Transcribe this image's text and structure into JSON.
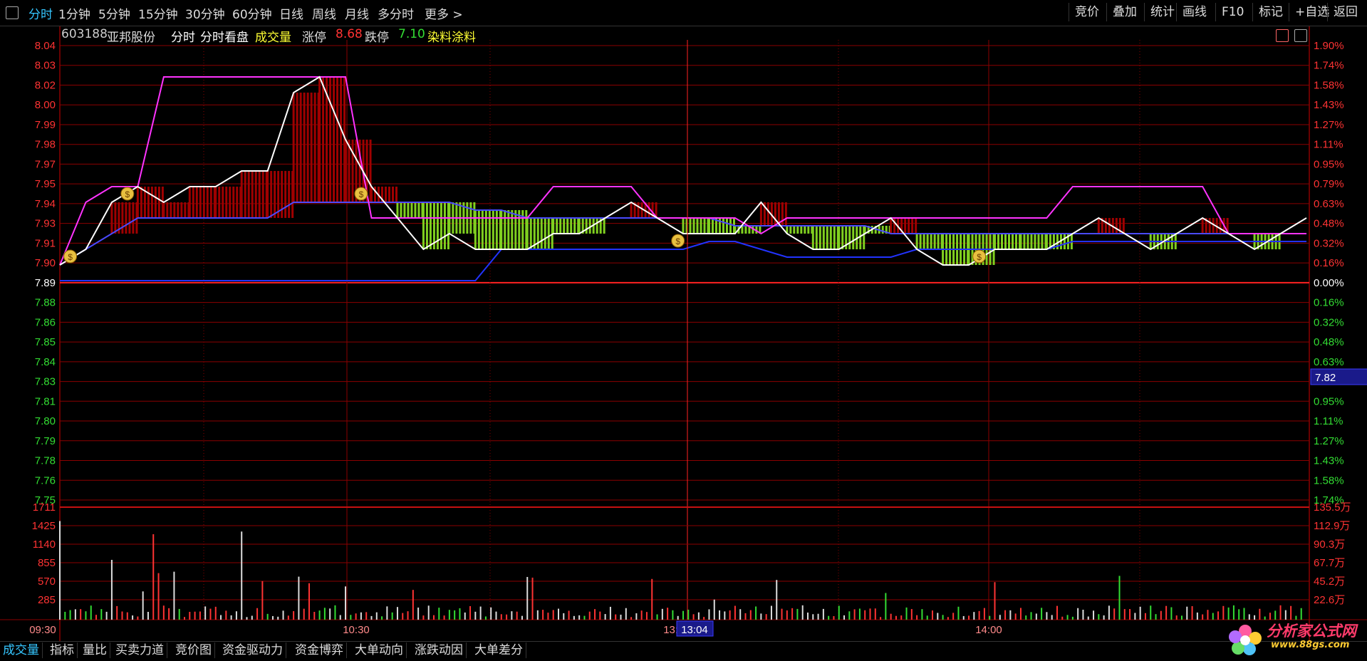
{
  "toolbar": {
    "periods": [
      "分时",
      "1分钟",
      "5分钟",
      "15分钟",
      "30分钟",
      "60分钟",
      "日线",
      "周线",
      "月线",
      "多分时",
      "更多 >"
    ],
    "actions": [
      "竞价",
      "叠加",
      "统计",
      "画线",
      "F10",
      "标记",
      "+自选",
      "返回"
    ]
  },
  "info": {
    "code": "603188",
    "name": "亚邦股份",
    "mode1": "分时",
    "mode2": "分时看盘",
    "volume_label": "成交量",
    "limit_up_label": "涨停",
    "limit_up": "8.68",
    "limit_down_label": "跌停",
    "limit_down": "7.10",
    "sector": "染料涂料"
  },
  "colors": {
    "up": "#ff3333",
    "down": "#33dd33",
    "grid": "#8b0000",
    "price": "#ffffff",
    "avg": "#2233dd",
    "magenta": "#ff33ff",
    "hist_up": "#a00000",
    "hist_down": "#80d020",
    "accent": "#35c6ff"
  },
  "chart_data": [
    {
      "type": "line",
      "name": "price-panel",
      "y_left_ticks": [
        "8.04",
        "8.03",
        "8.02",
        "8.00",
        "7.99",
        "7.98",
        "7.97",
        "7.95",
        "7.94",
        "7.93",
        "7.91",
        "7.90",
        "7.89",
        "7.88",
        "7.86",
        "7.85",
        "7.84",
        "7.83",
        "7.81",
        "7.80",
        "7.79",
        "7.78",
        "7.76",
        "7.75"
      ],
      "y_right_ticks": [
        "1.90%",
        "1.74%",
        "1.58%",
        "1.43%",
        "1.27%",
        "1.11%",
        "0.95%",
        "0.79%",
        "0.63%",
        "0.48%",
        "0.32%",
        "0.16%",
        "0.00%",
        "0.16%",
        "0.32%",
        "0.48%",
        "0.63%",
        "0.79%",
        "0.95%",
        "1.11%",
        "1.27%",
        "1.43%",
        "1.58%",
        "1.74%"
      ],
      "prev_close": 7.89,
      "ylim": [
        7.75,
        8.04
      ],
      "cursor_price_label": "7.82",
      "x": [
        0,
        5,
        10,
        15,
        20,
        25,
        30,
        35,
        40,
        45,
        50,
        55,
        60,
        65,
        70,
        75,
        80,
        85,
        90,
        95,
        100,
        105,
        110,
        115,
        120,
        125,
        130,
        135,
        140,
        145,
        150,
        155,
        160,
        165,
        170,
        175,
        180,
        185,
        190,
        195,
        200,
        205,
        210,
        215,
        220,
        225,
        230,
        235,
        240
      ],
      "price": [
        7.9,
        7.91,
        7.94,
        7.95,
        7.94,
        7.95,
        7.95,
        7.96,
        7.96,
        8.01,
        8.02,
        7.98,
        7.95,
        7.93,
        7.91,
        7.92,
        7.91,
        7.91,
        7.91,
        7.92,
        7.92,
        7.93,
        7.94,
        7.93,
        7.92,
        7.92,
        7.92,
        7.94,
        7.92,
        7.91,
        7.91,
        7.92,
        7.93,
        7.91,
        7.9,
        7.9,
        7.91,
        7.91,
        7.91,
        7.92,
        7.93,
        7.92,
        7.91,
        7.92,
        7.93,
        7.92,
        7.91,
        7.92,
        7.93
      ],
      "avg_price": [
        7.9,
        7.91,
        7.92,
        7.93,
        7.93,
        7.93,
        7.93,
        7.93,
        7.93,
        7.94,
        7.94,
        7.94,
        7.94,
        7.94,
        7.94,
        7.94,
        7.935,
        7.935,
        7.93,
        7.93,
        7.93,
        7.93,
        7.93,
        7.93,
        7.93,
        7.93,
        7.925,
        7.925,
        7.925,
        7.925,
        7.925,
        7.925,
        7.92,
        7.92,
        7.92,
        7.92,
        7.92,
        7.92,
        7.92,
        7.92,
        7.92,
        7.92,
        7.92,
        7.92,
        7.92,
        7.92,
        7.92,
        7.92,
        7.92
      ],
      "upper_band": [
        7.9,
        7.94,
        7.95,
        7.95,
        8.02,
        8.02,
        8.02,
        8.02,
        8.02,
        8.02,
        8.02,
        8.02,
        7.93,
        7.93,
        7.93,
        7.93,
        7.93,
        7.93,
        7.93,
        7.95,
        7.95,
        7.95,
        7.95,
        7.93,
        7.93,
        7.93,
        7.93,
        7.92,
        7.93,
        7.93,
        7.93,
        7.93,
        7.93,
        7.93,
        7.93,
        7.93,
        7.93,
        7.93,
        7.93,
        7.95,
        7.95,
        7.95,
        7.95,
        7.95,
        7.95,
        7.92,
        7.92,
        7.92,
        7.92
      ],
      "lower_band": [
        7.89,
        7.89,
        7.89,
        7.89,
        7.89,
        7.89,
        7.89,
        7.89,
        7.89,
        7.89,
        7.89,
        7.89,
        7.89,
        7.89,
        7.89,
        7.89,
        7.89,
        7.91,
        7.91,
        7.91,
        7.91,
        7.91,
        7.91,
        7.91,
        7.91,
        7.915,
        7.915,
        7.91,
        7.905,
        7.905,
        7.905,
        7.905,
        7.905,
        7.91,
        7.91,
        7.91,
        7.91,
        7.91,
        7.91,
        7.915,
        7.915,
        7.915,
        7.915,
        7.915,
        7.915,
        7.915,
        7.915,
        7.915,
        7.915
      ],
      "signal_marks": [
        2,
        13,
        58,
        119,
        177
      ]
    },
    {
      "type": "bar",
      "name": "volume-panel",
      "y_left_ticks": [
        "1711",
        "1425",
        "1140",
        "855",
        "570",
        "285"
      ],
      "y_right_ticks": [
        "135.5万",
        "112.9万",
        "90.3万",
        "67.7万",
        "45.2万",
        "22.6万"
      ],
      "ylim": [
        0,
        1711
      ],
      "x_ticks": [
        "09:30",
        "10:30",
        "13:00",
        "14:00"
      ],
      "cursor_time_label": "13:04"
    }
  ],
  "bottom_tabs": [
    "成交量",
    "指标",
    "量比",
    "买卖力道",
    "竞价图",
    "资金驱动力",
    "资金博弈",
    "大单动向",
    "涨跌动因",
    "大单差分"
  ],
  "watermark": {
    "title": "分析家公式网",
    "url": "www.88gs.com"
  }
}
